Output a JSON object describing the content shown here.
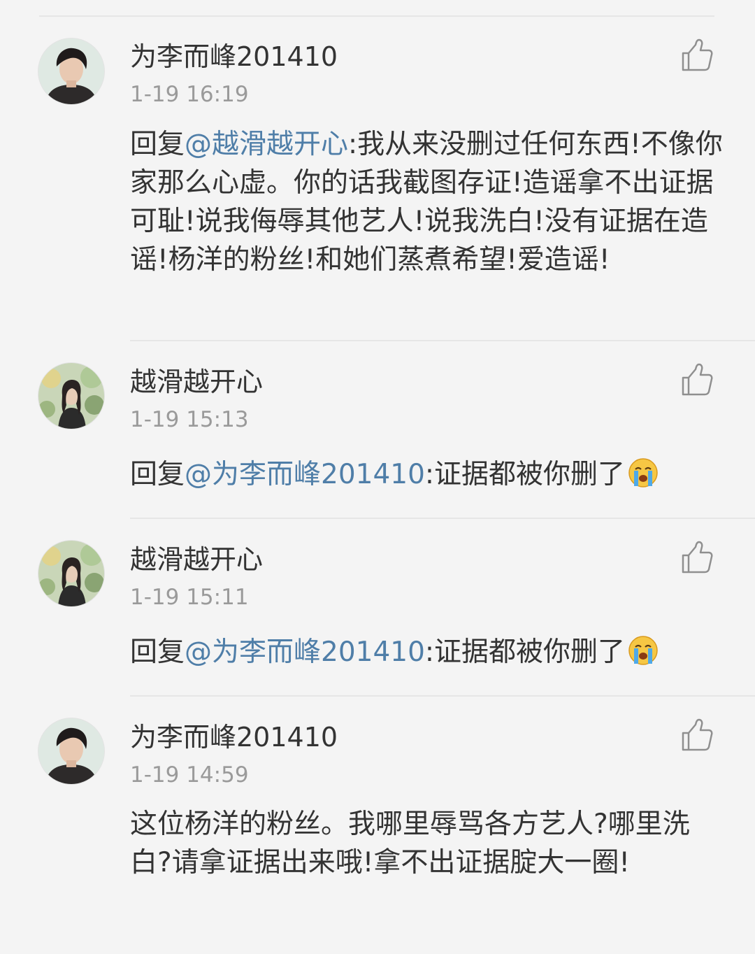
{
  "comments": [
    {
      "username": "为李而峰201410",
      "timestamp": "1-19 16:19",
      "reply_prefix": "回复",
      "mention": "@越滑越开心",
      "text": ":我从来没删过任何东西!不像你家那么心虚。你的话我截图存证!造谣拿不出证据可耻!说我侮辱其他艺人!说我洗白!没有证据在造谣!杨洋的粉丝!和她们蒸煮希望!爱造谣!",
      "avatar_icon": "male-avatar-photo"
    },
    {
      "username": "越滑越开心",
      "timestamp": "1-19 15:13",
      "reply_prefix": "回复",
      "mention": "@为李而峰201410",
      "text": ":证据都被你删了",
      "emoji": "crying-face-emoji",
      "avatar_icon": "female-avatar-photo"
    },
    {
      "username": "越滑越开心",
      "timestamp": "1-19 15:11",
      "reply_prefix": "回复",
      "mention": "@为李而峰201410",
      "text": ":证据都被你删了",
      "emoji": "crying-face-emoji",
      "avatar_icon": "female-avatar-photo"
    },
    {
      "username": "为李而峰201410",
      "timestamp": "1-19 14:59",
      "text": "这位杨洋的粉丝。我哪里辱骂各方艺人?哪里洗白?请拿证据出来哦!拿不出证据腚大一圈!",
      "avatar_icon": "male-avatar-photo"
    }
  ],
  "colors": {
    "background": "#f4f4f4",
    "text": "#333333",
    "mention": "#4f7ea8",
    "timestamp": "#9a9a9a",
    "divider": "#e6e6e6"
  }
}
